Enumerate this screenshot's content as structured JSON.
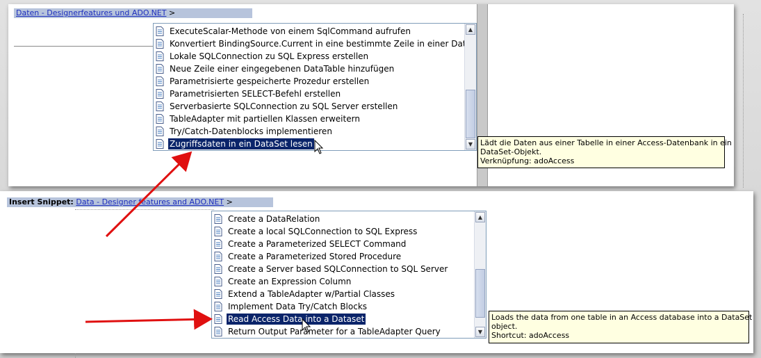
{
  "german": {
    "breadcrumb": {
      "link": "Daten - Designerfeatures und ADO.NET",
      "separator": ">"
    },
    "snippets": [
      "ExecuteScalar-Methode von einem SqlCommand aufrufen",
      "Konvertiert BindingSource.Current in eine bestimmte Zeile in einer DataTable.",
      "Lokale SQLConnection zu SQL Express erstellen",
      "Neue Zeile einer eingegebenen DataTable hinzufügen",
      "Parametrisierte gespeicherte Prozedur erstellen",
      "Parametrisierten SELECT-Befehl erstellen",
      "Serverbasierte SQLConnection zu SQL Server erstellen",
      "TableAdapter mit partiellen Klassen erweitern",
      "Try/Catch-Datenblocks implementieren",
      "Zugriffsdaten in ein DataSet lesen"
    ],
    "selected_index": 9,
    "tooltip": {
      "line1": "Lädt die Daten aus einer Tabelle in einer Access-Datenbank in ein",
      "line2": "DataSet-Objekt.",
      "line3": "Verknüpfung: adoAccess"
    },
    "scroll_position": 1.0
  },
  "english": {
    "breadcrumb": {
      "label": "Insert Snippet:",
      "link": "Data - Designer features and ADO.NET",
      "separator": ">"
    },
    "snippets": [
      "Create a DataRelation",
      "Create a local SQLConnection to SQL Express",
      "Create a Parameterized SELECT Command",
      "Create a Parameterized Stored Procedure",
      "Create a Server based SQLConnection to SQL Server",
      "Create an Expression Column",
      "Extend a TableAdapter w/Partial Classes",
      "Implement Data Try/Catch Blocks",
      "Read Access Data into a Dataset",
      "Return Output Parameter for a TableAdapter Query"
    ],
    "selected_index": 8,
    "tooltip": {
      "line1": "Loads the data from one table in an Access database into a DataSet",
      "line2": "object.",
      "line3": "Shortcut: adoAccess"
    },
    "scroll_position": 0.85
  },
  "colors": {
    "selection": "#0a246a",
    "breadcrumb_bg": "#b7c4dc",
    "link": "#1d2ebd",
    "tooltip_bg": "#ffffe1",
    "arrow": "#e01010"
  },
  "icons": {
    "snippet": "code-snippet-document-icon",
    "cursor": "mouse-pointer-icon",
    "scroll_up": "scroll-up-arrow-icon",
    "scroll_down": "scroll-down-arrow-icon"
  }
}
